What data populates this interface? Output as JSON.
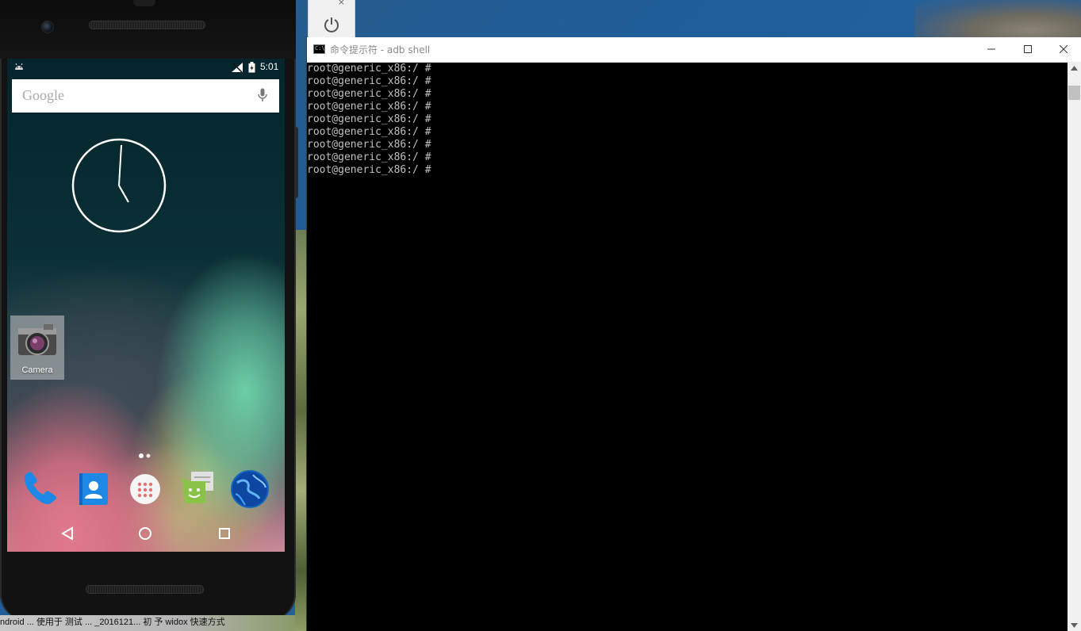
{
  "emulator": {
    "status_time": "5:01",
    "search_placeholder": "Google",
    "home_app_label": "Camera",
    "dock_icons": [
      "phone-icon",
      "contacts-icon",
      "app-drawer-icon",
      "messaging-icon",
      "browser-icon"
    ],
    "nav_icons": [
      "back-icon",
      "home-icon",
      "recents-icon"
    ],
    "clock_hands": {
      "hour": "5",
      "minute": "01"
    }
  },
  "terminal": {
    "title": "命令提示符 - adb  shell",
    "lines": [
      "root@generic_x86:/ #",
      "root@generic_x86:/ #",
      "root@generic_x86:/ #",
      "root@generic_x86:/ #",
      "root@generic_x86:/ #",
      "root@generic_x86:/ #",
      "root@generic_x86:/ #",
      "root@generic_x86:/ #",
      "root@generic_x86:/ #"
    ],
    "background": "#000000",
    "text_color": "#c0c0c0"
  },
  "power_widget": {
    "close_label": "×"
  },
  "taskbar_fragment": {
    "text": "ndroid ...   使用于 测试 ...   _2016121...     初 予 widox        快速方式"
  }
}
